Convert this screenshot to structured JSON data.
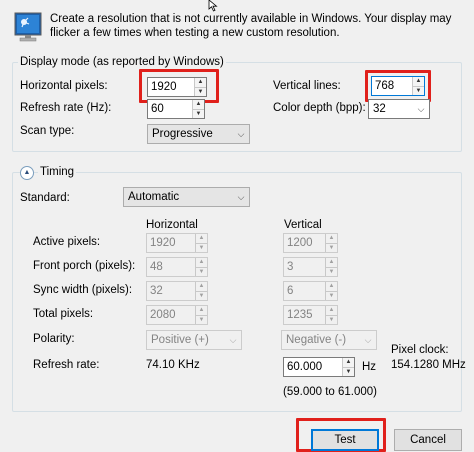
{
  "intro_text": "Create a resolution that is not currently available in Windows. Your display may flicker a few times when testing a new custom resolution.",
  "display_mode": {
    "legend": "Display mode (as reported by Windows)",
    "horizontal_pixels": {
      "label": "Horizontal pixels:",
      "value": "1920"
    },
    "vertical_lines": {
      "label": "Vertical lines:",
      "value": "768"
    },
    "refresh_rate": {
      "label": "Refresh rate (Hz):",
      "value": "60"
    },
    "color_depth": {
      "label": "Color depth (bpp):",
      "value": "32"
    },
    "scan_type": {
      "label": "Scan type:",
      "value": "Progressive"
    }
  },
  "timing": {
    "legend": "Timing",
    "standard": {
      "label": "Standard:",
      "value": "Automatic"
    },
    "col_horizontal": "Horizontal",
    "col_vertical": "Vertical",
    "rows": [
      {
        "label": "Active pixels:",
        "h": "1920",
        "v": "1200"
      },
      {
        "label": "Front porch (pixels):",
        "h": "48",
        "v": "3"
      },
      {
        "label": "Sync width (pixels):",
        "h": "32",
        "v": "6"
      },
      {
        "label": "Total pixels:",
        "h": "2080",
        "v": "1235"
      }
    ],
    "polarity": {
      "label": "Polarity:",
      "h": "Positive (+)",
      "v": "Negative (-)"
    },
    "refresh": {
      "label": "Refresh rate:",
      "h": "74.10 KHz",
      "v": "60.000",
      "v_unit": "Hz",
      "v_range": "(59.000 to 61.000)"
    },
    "pixel_clock": {
      "label": "Pixel clock:",
      "value": "154.1280 MHz"
    }
  },
  "buttons": {
    "test": "Test",
    "cancel": "Cancel"
  },
  "colors": {
    "highlight": "#e0201b",
    "focus": "#0078d7",
    "background": "#f0f0f0"
  }
}
